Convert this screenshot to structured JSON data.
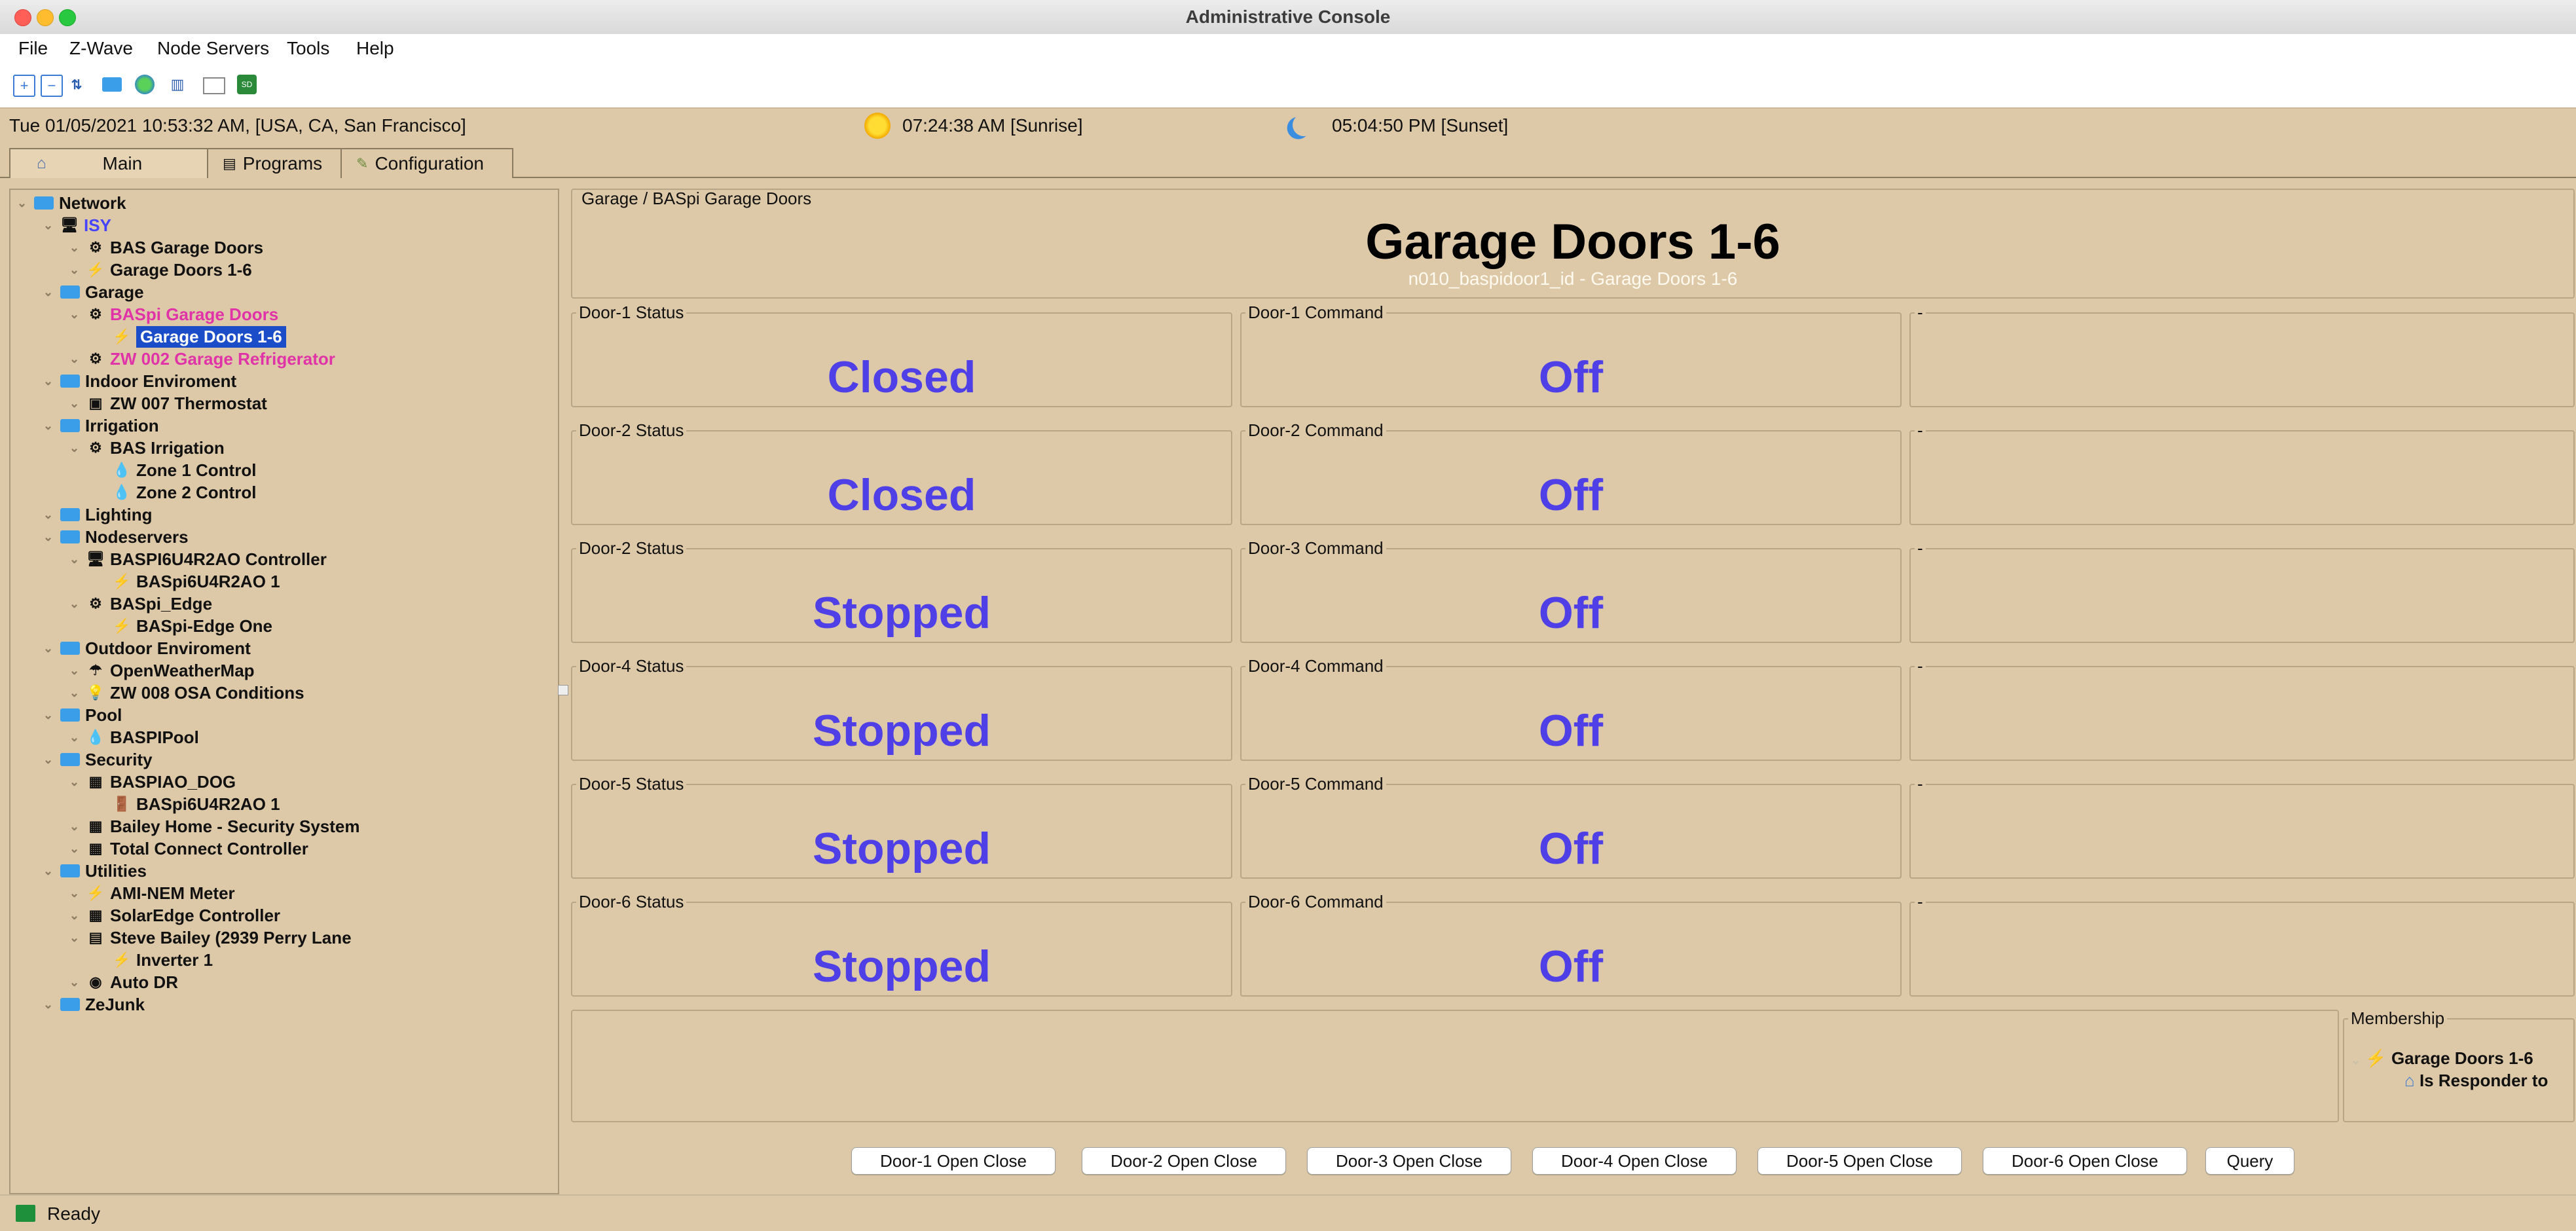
{
  "window": {
    "title": "Administrative Console"
  },
  "menu": [
    "File",
    "Z-Wave",
    "Node Servers",
    "Tools",
    "Help"
  ],
  "toolbar": [
    "expand-all-icon",
    "collapse-all-icon",
    "sort-az-icon",
    "folder-icon",
    "globe-icon",
    "chart-icon",
    "window-icon",
    "sd-card-icon"
  ],
  "status": {
    "datetime": "Tue 01/05/2021 10:53:32 AM,  [USA, CA, San Francisco]",
    "sunrise": "07:24:38 AM [Sunrise]",
    "sunset": "05:04:50 PM [Sunset]"
  },
  "tabs": [
    {
      "label": "Main",
      "icon": "home-icon"
    },
    {
      "label": "Programs",
      "icon": "document-icon"
    },
    {
      "label": "Configuration",
      "icon": "wrench-icon"
    }
  ],
  "tree": [
    {
      "label": "Network",
      "level": 0,
      "type": "folder"
    },
    {
      "label": "ISY",
      "level": 1,
      "type": "computer",
      "color": "#4444ff"
    },
    {
      "label": "BAS Garage Doors",
      "level": 2,
      "type": "nodeserver"
    },
    {
      "label": "Garage Doors 1-6",
      "level": 2,
      "type": "bolt"
    },
    {
      "label": "Garage",
      "level": 1,
      "type": "folder"
    },
    {
      "label": "BASpi Garage Doors",
      "level": 2,
      "type": "nodeserver",
      "color": "#e033a8"
    },
    {
      "label": "Garage Doors 1-6",
      "level": 3,
      "type": "bolt",
      "selected": true
    },
    {
      "label": "ZW 002 Garage Refrigerator",
      "level": 2,
      "type": "nodeserver",
      "color": "#e033a8"
    },
    {
      "label": "Indoor Enviroment",
      "level": 1,
      "type": "folder"
    },
    {
      "label": "ZW 007 Thermostat",
      "level": 2,
      "type": "thermostat"
    },
    {
      "label": "Irrigation",
      "level": 1,
      "type": "folder"
    },
    {
      "label": "BAS Irrigation",
      "level": 2,
      "type": "nodeserver"
    },
    {
      "label": "Zone 1 Control",
      "level": 3,
      "type": "water"
    },
    {
      "label": "Zone 2 Control",
      "level": 3,
      "type": "water"
    },
    {
      "label": "Lighting",
      "level": 1,
      "type": "folder"
    },
    {
      "label": "Nodeservers",
      "level": 1,
      "type": "folder"
    },
    {
      "label": "BASPI6U4R2AO Controller",
      "level": 2,
      "type": "computer"
    },
    {
      "label": "BASpi6U4R2AO 1",
      "level": 3,
      "type": "bolt"
    },
    {
      "label": "BASpi_Edge",
      "level": 2,
      "type": "nodeserver"
    },
    {
      "label": "BASpi-Edge One",
      "level": 3,
      "type": "bolt"
    },
    {
      "label": "Outdoor Enviroment",
      "level": 1,
      "type": "folder"
    },
    {
      "label": "OpenWeatherMap",
      "level": 2,
      "type": "umbrella"
    },
    {
      "label": "ZW 008 OSA Conditions",
      "level": 2,
      "type": "bulb"
    },
    {
      "label": "Pool",
      "level": 1,
      "type": "folder"
    },
    {
      "label": "BASPIPool",
      "level": 2,
      "type": "water"
    },
    {
      "label": "Security",
      "level": 1,
      "type": "folder"
    },
    {
      "label": "BASPIAO_DOG",
      "level": 2,
      "type": "grid"
    },
    {
      "label": "BASpi6U4R2AO 1",
      "level": 3,
      "type": "door"
    },
    {
      "label": "Bailey Home - Security System",
      "level": 2,
      "type": "grid"
    },
    {
      "label": "Total Connect Controller",
      "level": 2,
      "type": "grid"
    },
    {
      "label": "Utilities",
      "level": 1,
      "type": "folder"
    },
    {
      "label": "AMI-NEM Meter",
      "level": 2,
      "type": "bolt"
    },
    {
      "label": "SolarEdge Controller",
      "level": 2,
      "type": "grid"
    },
    {
      "label": "Steve Bailey (2939 Perry Lane",
      "level": 2,
      "type": "panel"
    },
    {
      "label": "Inverter 1",
      "level": 3,
      "type": "bolt"
    },
    {
      "label": "Auto DR",
      "level": 2,
      "type": "globe"
    },
    {
      "label": "ZeJunk",
      "level": 1,
      "type": "folder"
    }
  ],
  "detail": {
    "breadcrumb": "Garage / BASpi Garage Doors",
    "title": "Garage Doors 1-6",
    "address": "n010_baspidoor1_id - Garage Doors 1-6",
    "rows": [
      {
        "status_label": "Door-1 Status",
        "status_value": "Closed",
        "command_label": "Door-1 Command",
        "command_value": "Off",
        "extra_label": "-"
      },
      {
        "status_label": "Door-2 Status",
        "status_value": "Closed",
        "command_label": "Door-2 Command",
        "command_value": "Off",
        "extra_label": "-"
      },
      {
        "status_label": "Door-2 Status",
        "status_value": "Stopped",
        "command_label": "Door-3 Command",
        "command_value": "Off",
        "extra_label": "-"
      },
      {
        "status_label": "Door-4 Status",
        "status_value": "Stopped",
        "command_label": "Door-4 Command",
        "command_value": "Off",
        "extra_label": "-"
      },
      {
        "status_label": "Door-5 Status",
        "status_value": "Stopped",
        "command_label": "Door-5 Command",
        "command_value": "Off",
        "extra_label": "-"
      },
      {
        "status_label": "Door-6 Status",
        "status_value": "Stopped",
        "command_label": "Door-6 Command",
        "command_value": "Off",
        "extra_label": "-"
      }
    ],
    "membership": {
      "legend": "Membership",
      "group": "Garage Doors 1-6",
      "role": "Is Responder to"
    },
    "buttons": [
      "Door-1 Open Close",
      "Door-2 Open Close",
      "Door-3 Open Close",
      "Door-4 Open Close",
      "Door-5 Open Close",
      "Door-6 Open Close",
      "Query"
    ]
  },
  "footer": {
    "status": "Ready"
  }
}
